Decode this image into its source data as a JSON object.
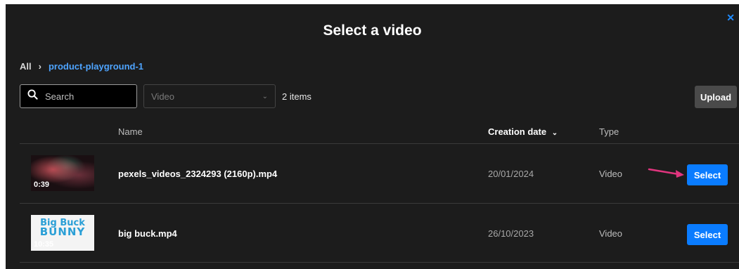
{
  "modal": {
    "title": "Select a video",
    "close_icon": "close-icon"
  },
  "breadcrumb": {
    "root": "All",
    "separator": "›",
    "folder": "product-playground-1"
  },
  "toolbar": {
    "search_placeholder": "Search",
    "filter_value": "Video",
    "item_count": "2 items",
    "upload_label": "Upload"
  },
  "table": {
    "headers": {
      "name": "Name",
      "creation_date": "Creation date",
      "type": "Type"
    },
    "rows": [
      {
        "duration": "0:39",
        "name": "pexels_videos_2324293 (2160p).mp4",
        "date": "20/01/2024",
        "type": "Video",
        "action": "Select"
      },
      {
        "duration": "10:35",
        "name": "big buck.mp4",
        "date": "26/10/2023",
        "type": "Video",
        "action": "Select"
      }
    ]
  },
  "colors": {
    "accent": "#0a7cff",
    "link": "#4ea4ff",
    "background": "#1c1c1c",
    "annotation_arrow": "#e0357e"
  }
}
